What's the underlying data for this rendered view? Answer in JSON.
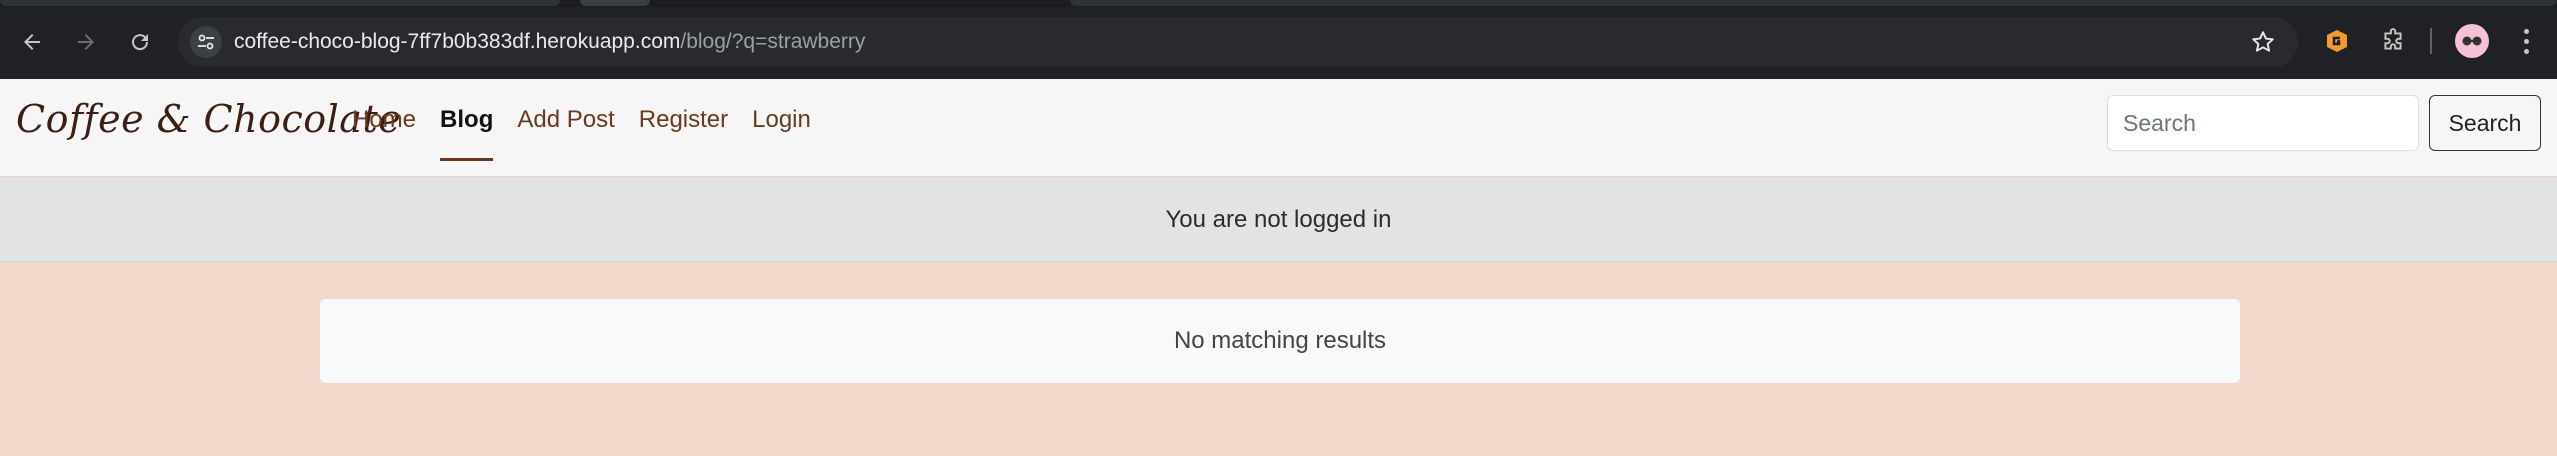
{
  "browser": {
    "url_host": "coffee-choco-blog-7ff7b0b383df.herokuapp.com",
    "url_path": "/blog/?q=strawberry"
  },
  "site": {
    "brand": "Coffee & Chocolate",
    "nav": [
      {
        "label": "Home",
        "active": false
      },
      {
        "label": "Blog",
        "active": true
      },
      {
        "label": "Add Post",
        "active": false
      },
      {
        "label": "Register",
        "active": false
      },
      {
        "label": "Login",
        "active": false
      }
    ],
    "search": {
      "placeholder": "Search",
      "button_label": "Search"
    },
    "colors": {
      "background": "#f3d9cb",
      "nav_link": "#6b3820",
      "brand": "#3c1f14"
    }
  },
  "status": {
    "message": "You are not logged in"
  },
  "results": {
    "message": "No matching results"
  }
}
